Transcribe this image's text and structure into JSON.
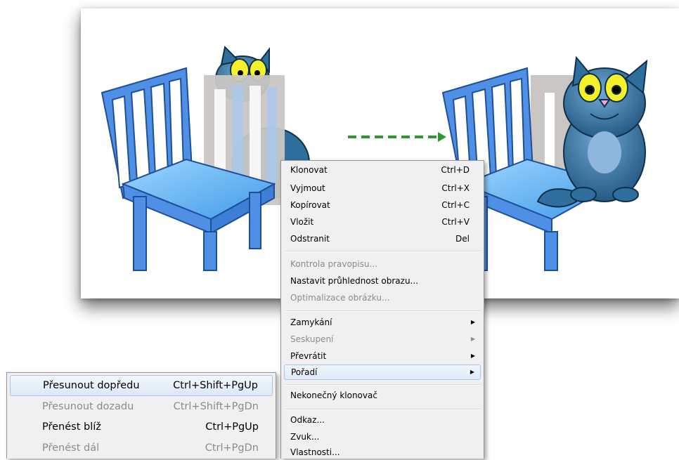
{
  "context_menu": {
    "items": [
      {
        "label": "Klonovat",
        "shortcut": "Ctrl+D"
      },
      {
        "label": "Vyjmout",
        "shortcut": "Ctrl+X"
      },
      {
        "label": "Kopírovat",
        "shortcut": "Ctrl+C"
      },
      {
        "label": "Vložit",
        "shortcut": "Ctrl+V"
      },
      {
        "label": "Odstranit",
        "shortcut": "Del"
      },
      {
        "label": "Kontrola pravopisu...",
        "disabled": true
      },
      {
        "label": "Nastavit průhlednost obrazu..."
      },
      {
        "label": "Optimalizace obrázku...",
        "disabled": true
      },
      {
        "label": "Zamykání",
        "submenu": true
      },
      {
        "label": "Seskupení",
        "submenu": true,
        "disabled": true
      },
      {
        "label": "Převrátit",
        "submenu": true
      },
      {
        "label": "Pořadí",
        "submenu": true,
        "highlighted": true
      },
      {
        "label": "Nekonečný klonovač"
      },
      {
        "label": "Odkaz..."
      },
      {
        "label": "Zvuk..."
      },
      {
        "label": "Vlastnosti..."
      }
    ]
  },
  "submenu": {
    "items": [
      {
        "label": "Přesunout dopředu",
        "shortcut": "Ctrl+Shift+PgUp",
        "highlighted": true
      },
      {
        "label": "Přesunout dozadu",
        "shortcut": "Ctrl+Shift+PgDn",
        "disabled": true
      },
      {
        "label": "Přenést blíž",
        "shortcut": "Ctrl+PgUp"
      },
      {
        "label": "Přenést dál",
        "shortcut": "Ctrl+PgDn",
        "disabled": true
      }
    ]
  },
  "colors": {
    "chair": "#4f8fe6",
    "chair_seat": "#62b4f5",
    "cat": "#2f6f9e",
    "arrow": "#2a9a2a",
    "shadow": "#bfbcba"
  },
  "icons": {
    "submenu_arrow": "triangle-right-icon"
  }
}
